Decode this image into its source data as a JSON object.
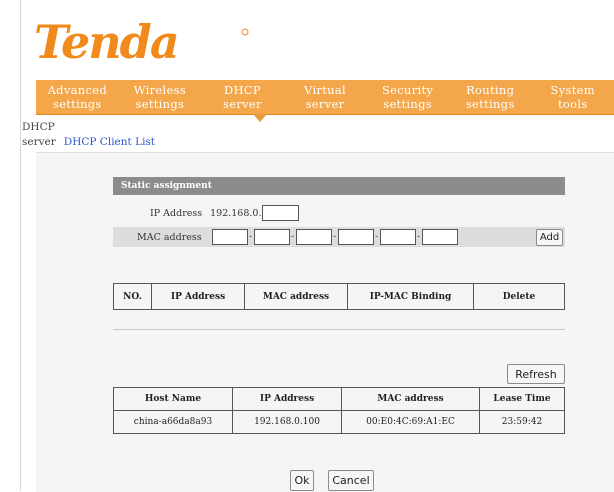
{
  "logo": {
    "text": "Tenda"
  },
  "nav": [
    {
      "line1": "Advanced",
      "line2": "settings"
    },
    {
      "line1": "Wireless",
      "line2": "settings"
    },
    {
      "line1": "DHCP",
      "line2": "server"
    },
    {
      "line1": "Virtual",
      "line2": "server"
    },
    {
      "line1": "Security",
      "line2": "settings"
    },
    {
      "line1": "Routing",
      "line2": "settings"
    },
    {
      "line1": "System",
      "line2": "tools"
    }
  ],
  "subnav": {
    "line1": "DHCP",
    "line2": "server",
    "link": "DHCP Client List"
  },
  "static": {
    "title": "Static assignment",
    "ip_label": "IP Address",
    "ip_prefix": "192.168.0.",
    "ip_value": "",
    "mac_label": "MAC address",
    "add_label": "Add"
  },
  "binding_table": {
    "headers": [
      "NO.",
      "IP Address",
      "MAC address",
      "IP-MAC Binding",
      "Delete"
    ]
  },
  "clients": {
    "refresh_label": "Refresh",
    "headers": [
      "Host Name",
      "IP Address",
      "MAC address",
      "Lease Time"
    ],
    "rows": [
      {
        "host": "china-a66da8a93",
        "ip": "192.168.0.100",
        "mac": "00:E0:4C:69:A1:EC",
        "lease": "23:59:42"
      }
    ]
  },
  "buttons": {
    "ok": "Ok",
    "cancel": "Cancel"
  },
  "colors": {
    "nav_bg": "#f4a64a",
    "logo": "#f08a1c",
    "link": "#2a55c8",
    "section_bar": "#8c8c8c"
  }
}
